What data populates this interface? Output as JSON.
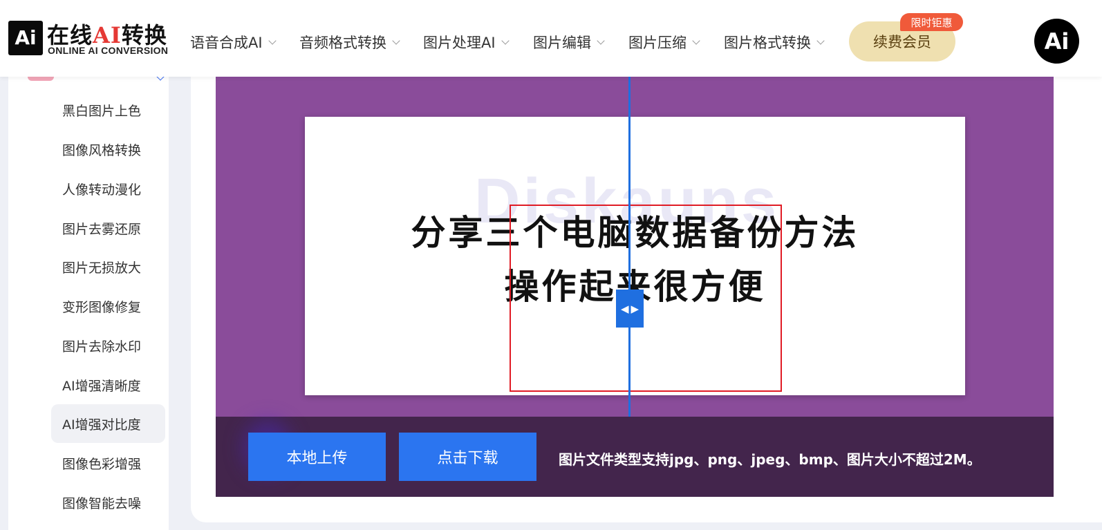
{
  "header": {
    "logo_mark": "Ai",
    "logo_title_cn_a": "在线",
    "logo_title_ai": "AI",
    "logo_title_cn_b": "转换",
    "logo_subtitle": "ONLINE AI CONVERSION",
    "nav": [
      {
        "label": "语音合成AI"
      },
      {
        "label": "音频格式转换"
      },
      {
        "label": "图片处理AI"
      },
      {
        "label": "图片编辑"
      },
      {
        "label": "图片压缩"
      },
      {
        "label": "图片格式转换"
      }
    ],
    "vip_label": "续费会员",
    "vip_badge": "限时钜惠",
    "avatar_text": "Ai"
  },
  "sidebar": {
    "items": [
      {
        "label": "黑白图片上色"
      },
      {
        "label": "图像风格转换"
      },
      {
        "label": "人像转动漫化"
      },
      {
        "label": "图片去雾还原"
      },
      {
        "label": "图片无损放大"
      },
      {
        "label": "变形图像修复"
      },
      {
        "label": "图片去除水印"
      },
      {
        "label": "AI增强清晰度"
      },
      {
        "label": "AI增强对比度",
        "active": true
      },
      {
        "label": "图像色彩增强"
      },
      {
        "label": "图像智能去噪"
      }
    ]
  },
  "editor": {
    "image_watermark": "Diskauns",
    "image_line1": "分享三个电脑数据备份方法",
    "image_line2": "操作起来很方便",
    "upload_label": "本地上传",
    "download_label": "点击下载",
    "hint": "图片文件类型支持jpg、png、jpeg、bmp、图片大小不超过2M。"
  },
  "colors": {
    "editor_bg": "#8a4c9a",
    "toolbar_bg": "#43254c",
    "accent_blue": "#2b75f0",
    "selection_red": "#e01b24",
    "vip_gold": "#efe0b0",
    "badge_red": "#f05a3a"
  }
}
